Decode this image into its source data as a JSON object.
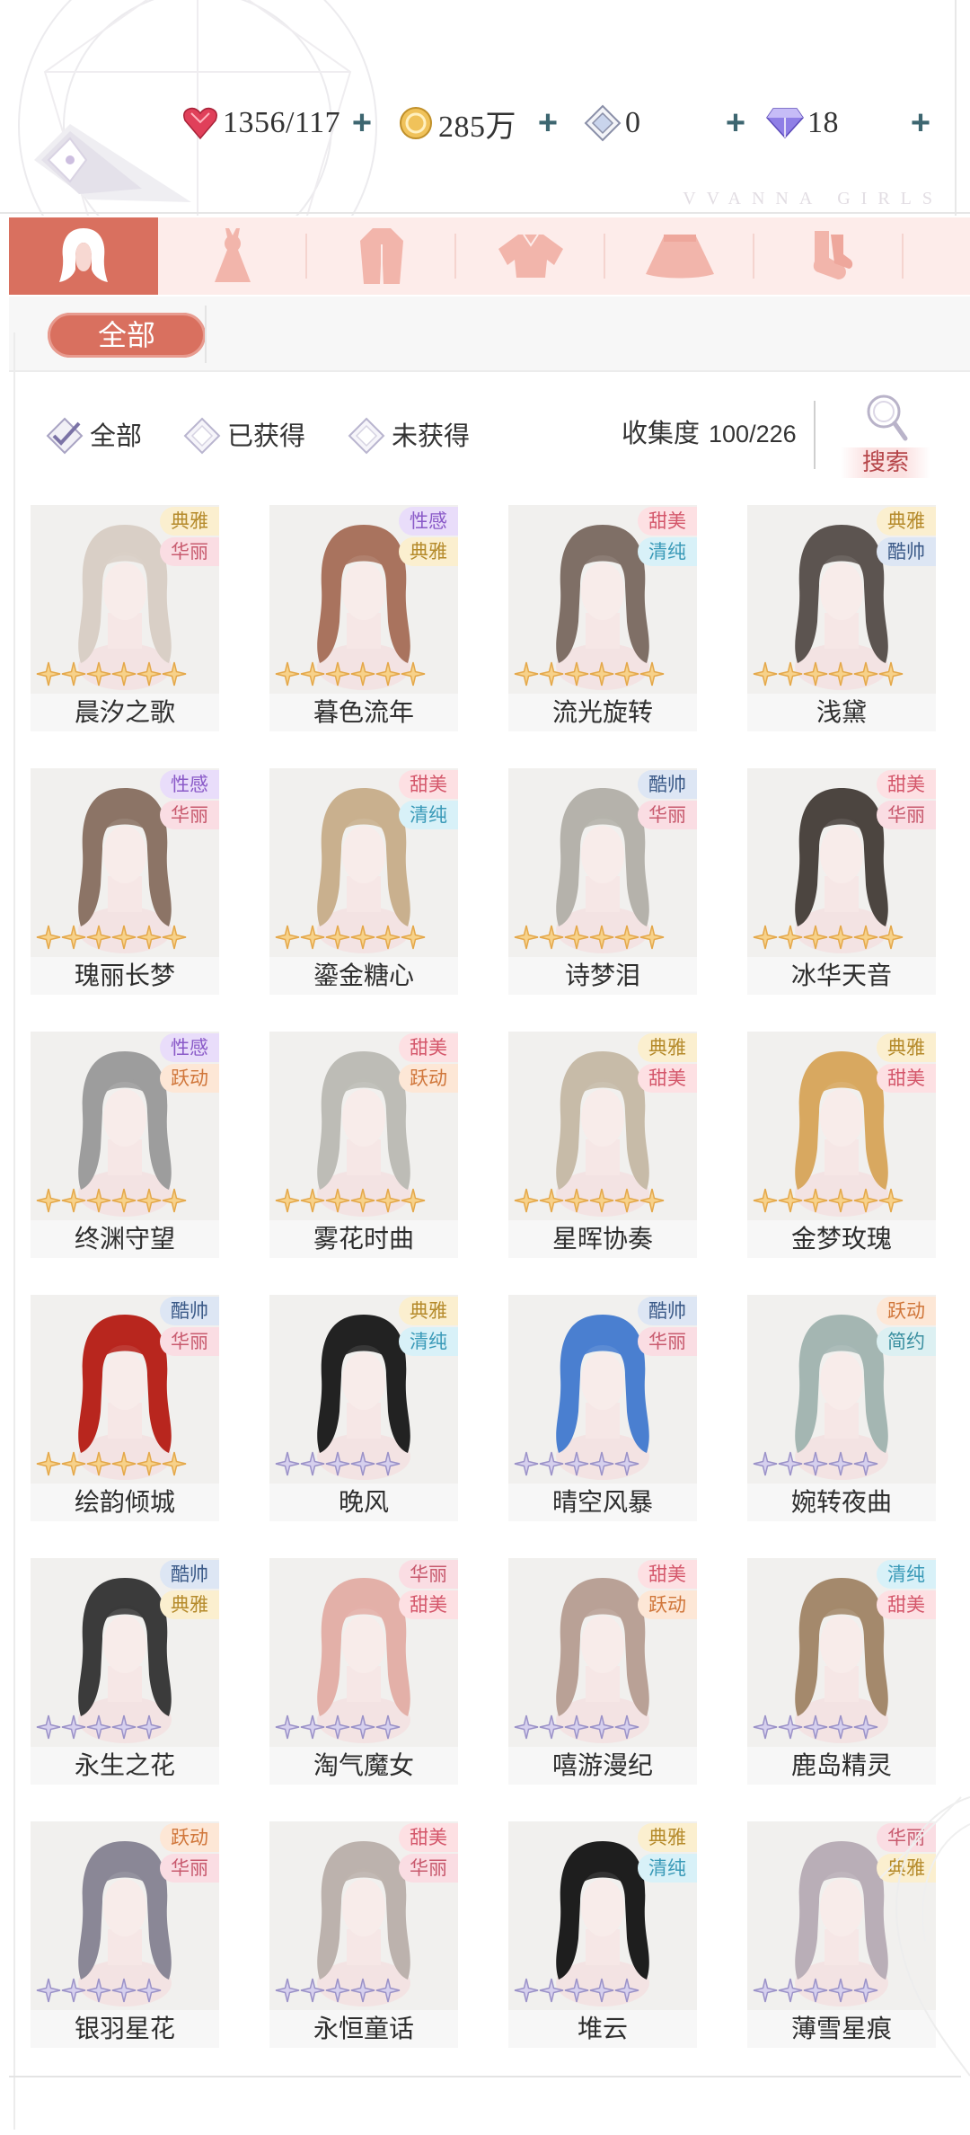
{
  "resources": [
    {
      "icon": "heart-gem-icon",
      "value": "1356/117"
    },
    {
      "icon": "gold-coin-icon",
      "value": "285万"
    },
    {
      "icon": "crystal-icon",
      "value": "0"
    },
    {
      "icon": "diamond-icon",
      "value": "18"
    }
  ],
  "brand_watermark": "VVANNA GIRLS",
  "categories": [
    {
      "icon": "hair-icon",
      "active": true
    },
    {
      "icon": "dress-icon",
      "active": false
    },
    {
      "icon": "coat-icon",
      "active": false
    },
    {
      "icon": "top-icon",
      "active": false
    },
    {
      "icon": "skirt-icon",
      "active": false
    },
    {
      "icon": "socks-icon",
      "active": false
    }
  ],
  "sub_filter": {
    "all_label": "全部"
  },
  "filters": {
    "all": "全部",
    "owned": "已获得",
    "unowned": "未获得"
  },
  "collection": {
    "label": "收集度",
    "value": "100/226"
  },
  "search_label": "搜索",
  "tag_colors": {
    "典雅": {
      "fg": "#b58a2a",
      "bg": "#fbefcf"
    },
    "华丽": {
      "fg": "#c85a6e",
      "bg": "#fadde3"
    },
    "性感": {
      "fg": "#8a5ac8",
      "bg": "#e9ddfa"
    },
    "甜美": {
      "fg": "#d4566a",
      "bg": "#fde0e3"
    },
    "清纯": {
      "fg": "#3a9ab8",
      "bg": "#d8f1f8"
    },
    "酷帅": {
      "fg": "#3b5a88",
      "bg": "#dde6f4"
    },
    "跃动": {
      "fg": "#d0763a",
      "bg": "#fde7d6"
    },
    "简约": {
      "fg": "#3a8fa0",
      "bg": "#dcf0f2"
    }
  },
  "items": [
    {
      "name": "晨汐之歌",
      "tags": [
        "典雅",
        "华丽"
      ],
      "stars": 6,
      "star_color": "gold",
      "hair": "#d9cfc6"
    },
    {
      "name": "暮色流年",
      "tags": [
        "性感",
        "典雅"
      ],
      "stars": 6,
      "star_color": "gold",
      "hair": "#a9735e"
    },
    {
      "name": "流光旋转",
      "tags": [
        "甜美",
        "清纯"
      ],
      "stars": 6,
      "star_color": "gold",
      "hair": "#7f6f66"
    },
    {
      "name": "浅黛",
      "tags": [
        "典雅",
        "酷帅"
      ],
      "stars": 6,
      "star_color": "gold",
      "hair": "#5c5450"
    },
    {
      "name": "瑰丽长梦",
      "tags": [
        "性感",
        "华丽"
      ],
      "stars": 6,
      "star_color": "gold",
      "hair": "#8c7466"
    },
    {
      "name": "鎏金糖心",
      "tags": [
        "甜美",
        "清纯"
      ],
      "stars": 6,
      "star_color": "gold",
      "hair": "#c9b08e"
    },
    {
      "name": "诗梦泪",
      "tags": [
        "酷帅",
        "华丽"
      ],
      "stars": 6,
      "star_color": "gold",
      "hair": "#b5b2ab"
    },
    {
      "name": "冰华天音",
      "tags": [
        "甜美",
        "华丽"
      ],
      "stars": 6,
      "star_color": "gold",
      "hair": "#4c4540"
    },
    {
      "name": "终渊守望",
      "tags": [
        "性感",
        "跃动"
      ],
      "stars": 6,
      "star_color": "gold",
      "hair": "#9d9d9d"
    },
    {
      "name": "雾花时曲",
      "tags": [
        "甜美",
        "跃动"
      ],
      "stars": 6,
      "star_color": "gold",
      "hair": "#bdbcb6"
    },
    {
      "name": "星晖协奏",
      "tags": [
        "典雅",
        "甜美"
      ],
      "stars": 6,
      "star_color": "gold",
      "hair": "#c7bba8"
    },
    {
      "name": "金梦玫瑰",
      "tags": [
        "典雅",
        "甜美"
      ],
      "stars": 6,
      "star_color": "gold",
      "hair": "#d8a860"
    },
    {
      "name": "绘韵倾城",
      "tags": [
        "酷帅",
        "华丽"
      ],
      "stars": 6,
      "star_color": "gold",
      "hair": "#b8261e"
    },
    {
      "name": "晚风",
      "tags": [
        "典雅",
        "清纯"
      ],
      "stars": 5,
      "star_color": "lilac",
      "hair": "#222222"
    },
    {
      "name": "晴空风暴",
      "tags": [
        "酷帅",
        "华丽"
      ],
      "stars": 5,
      "star_color": "lilac",
      "hair": "#4a7fd0"
    },
    {
      "name": "婉转夜曲",
      "tags": [
        "跃动",
        "简约"
      ],
      "stars": 5,
      "star_color": "lilac",
      "hair": "#a4b6b2"
    },
    {
      "name": "永生之花",
      "tags": [
        "酷帅",
        "典雅"
      ],
      "stars": 5,
      "star_color": "lilac",
      "hair": "#3b3b3b"
    },
    {
      "name": "淘气魔女",
      "tags": [
        "华丽",
        "甜美"
      ],
      "stars": 5,
      "star_color": "lilac",
      "hair": "#e3b0a8"
    },
    {
      "name": "嘻游漫纪",
      "tags": [
        "甜美",
        "跃动"
      ],
      "stars": 5,
      "star_color": "lilac",
      "hair": "#b9a196"
    },
    {
      "name": "鹿岛精灵",
      "tags": [
        "清纯",
        "甜美"
      ],
      "stars": 5,
      "star_color": "lilac",
      "hair": "#a4896c"
    },
    {
      "name": "银羽星花",
      "tags": [
        "跃动",
        "华丽"
      ],
      "stars": 5,
      "star_color": "lilac",
      "hair": "#8a8796"
    },
    {
      "name": "永恒童话",
      "tags": [
        "甜美",
        "华丽"
      ],
      "stars": 5,
      "star_color": "lilac",
      "hair": "#bcb2ad"
    },
    {
      "name": "堆云",
      "tags": [
        "典雅",
        "清纯"
      ],
      "stars": 5,
      "star_color": "lilac",
      "hair": "#1e1e1e"
    },
    {
      "name": "薄雪星痕",
      "tags": [
        "华丽",
        "典雅"
      ],
      "stars": 5,
      "star_color": "lilac",
      "hair": "#b9aeb7"
    }
  ]
}
